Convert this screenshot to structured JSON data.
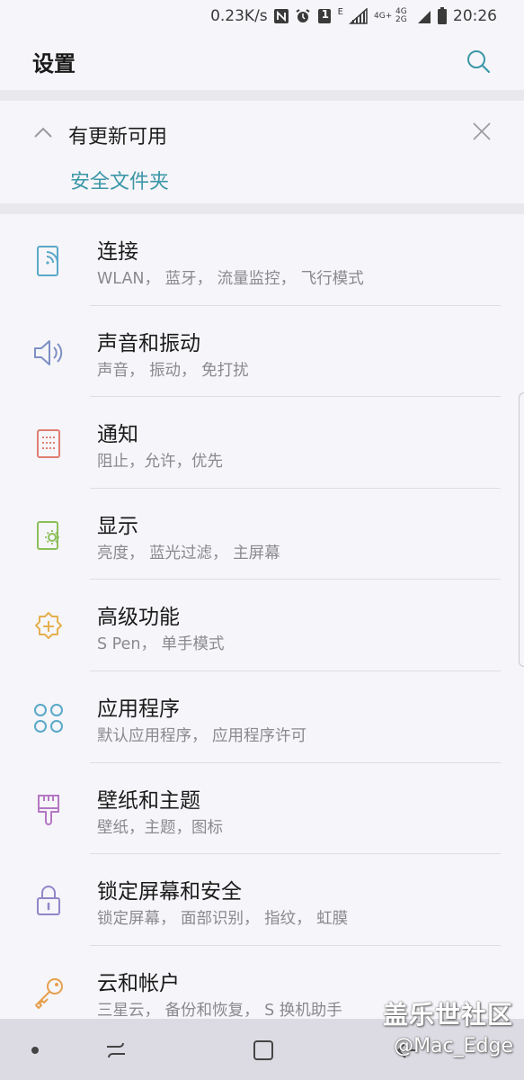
{
  "status_bar": {
    "speed": "0.23K/s",
    "network_1": "4G+",
    "network_2": "4G 2G",
    "time": "20:26",
    "sim_badge": "1",
    "e_label": "E"
  },
  "header": {
    "title": "设置"
  },
  "update_card": {
    "title": "有更新可用",
    "link": "安全文件夹"
  },
  "settings": [
    {
      "title": "连接",
      "subtitle": "WLAN， 蓝牙， 流量监控， 飞行模式",
      "icon": "connections-icon",
      "color": "#5aa9c8"
    },
    {
      "title": "声音和振动",
      "subtitle": "声音， 振动， 免打扰",
      "icon": "sound-icon",
      "color": "#7d8fc4"
    },
    {
      "title": "通知",
      "subtitle": "阻止，允许，优先",
      "icon": "notifications-icon",
      "color": "#e07f72"
    },
    {
      "title": "显示",
      "subtitle": "亮度， 蓝光过滤， 主屏幕",
      "icon": "display-icon",
      "color": "#8cbf5a"
    },
    {
      "title": "高级功能",
      "subtitle": "S Pen， 单手模式",
      "icon": "advanced-features-icon",
      "color": "#e5b04e"
    },
    {
      "title": "应用程序",
      "subtitle": "默认应用程序， 应用程序许可",
      "icon": "apps-icon",
      "color": "#5aa9c8"
    },
    {
      "title": "壁纸和主题",
      "subtitle": "壁纸，主题，图标",
      "icon": "wallpaper-brush-icon",
      "color": "#b478c4"
    },
    {
      "title": "锁定屏幕和安全",
      "subtitle": "锁定屏幕， 面部识别， 指纹， 虹膜",
      "icon": "lock-icon",
      "color": "#8f87c9"
    },
    {
      "title": "云和帐户",
      "subtitle": "三星云， 备份和恢复， S 换机助手",
      "icon": "key-icon",
      "color": "#e5a04e"
    }
  ],
  "watermark": {
    "line1": "盖乐世社区",
    "line2": "@Mac_Edge"
  }
}
